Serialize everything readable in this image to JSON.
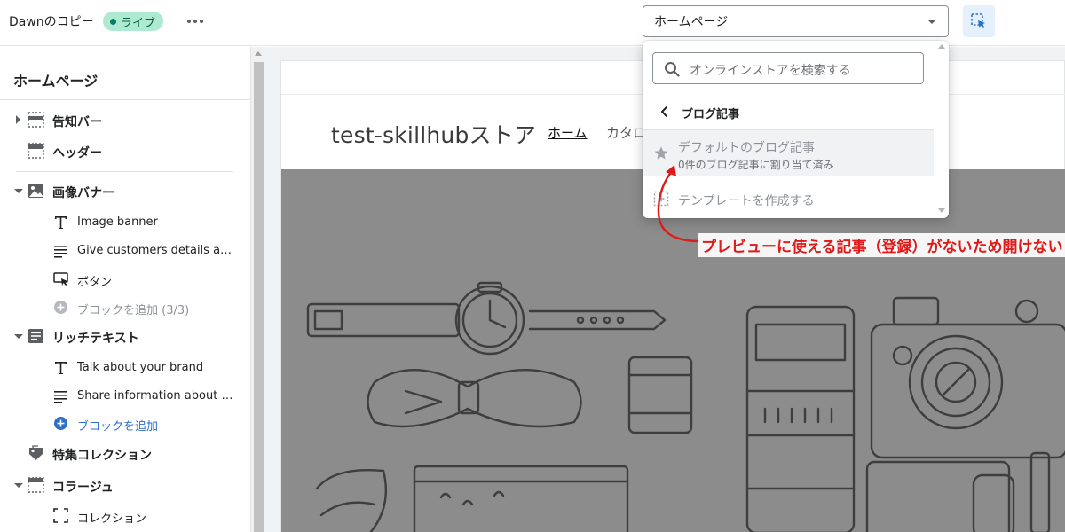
{
  "topbar": {
    "theme_name": "Dawnのコピー",
    "status_badge": "ライブ",
    "page_select_value": "ホームページ"
  },
  "colors": {
    "live_badge_bg": "#aee9d1",
    "live_dot": "#008060",
    "link_blue": "#2c6ecb",
    "annotation_red": "#e01a1a",
    "banner_gray": "#8c8c8c"
  },
  "sidebar": {
    "title": "ホームページ",
    "sections": [
      {
        "label": "告知バー",
        "icon": "announcement-bar-icon",
        "expanded": false
      },
      {
        "label": "ヘッダー",
        "icon": "header-icon"
      },
      {
        "label": "画像バナー",
        "icon": "image-icon",
        "expanded": true,
        "blocks": [
          {
            "label": "Image banner",
            "icon": "text-icon"
          },
          {
            "label": "Give customers details abo...",
            "icon": "paragraph-icon"
          },
          {
            "label": "ボタン",
            "icon": "button-icon"
          },
          {
            "label": "ブロックを追加 (3/3)",
            "icon": "add-circle-icon",
            "disabled": true
          }
        ]
      },
      {
        "label": "リッチテキスト",
        "icon": "rich-text-icon",
        "expanded": true,
        "blocks": [
          {
            "label": "Talk about your brand",
            "icon": "text-icon"
          },
          {
            "label": "Share information about yo...",
            "icon": "paragraph-icon"
          },
          {
            "label": "ブロックを追加",
            "icon": "add-circle-icon"
          }
        ]
      },
      {
        "label": "特集コレクション",
        "icon": "tag-icon"
      },
      {
        "label": "コラージュ",
        "icon": "collage-icon",
        "expanded": true,
        "blocks": [
          {
            "label": "コレクション",
            "icon": "collection-icon"
          }
        ]
      }
    ]
  },
  "preview": {
    "store_name": "test-skillhubストア",
    "nav_home": "ホーム",
    "nav_catalog": "カタロ"
  },
  "popover": {
    "search_placeholder": "オンラインストアを検索する",
    "back_label": "ブログ記事",
    "item_title": "デフォルトのブログ記事",
    "item_subtitle": "0件のブログ記事に割り当て済み",
    "create_label": "テンプレートを作成する"
  },
  "annotation": {
    "text": "プレビューに使える記事（登録）がないため開けない"
  }
}
